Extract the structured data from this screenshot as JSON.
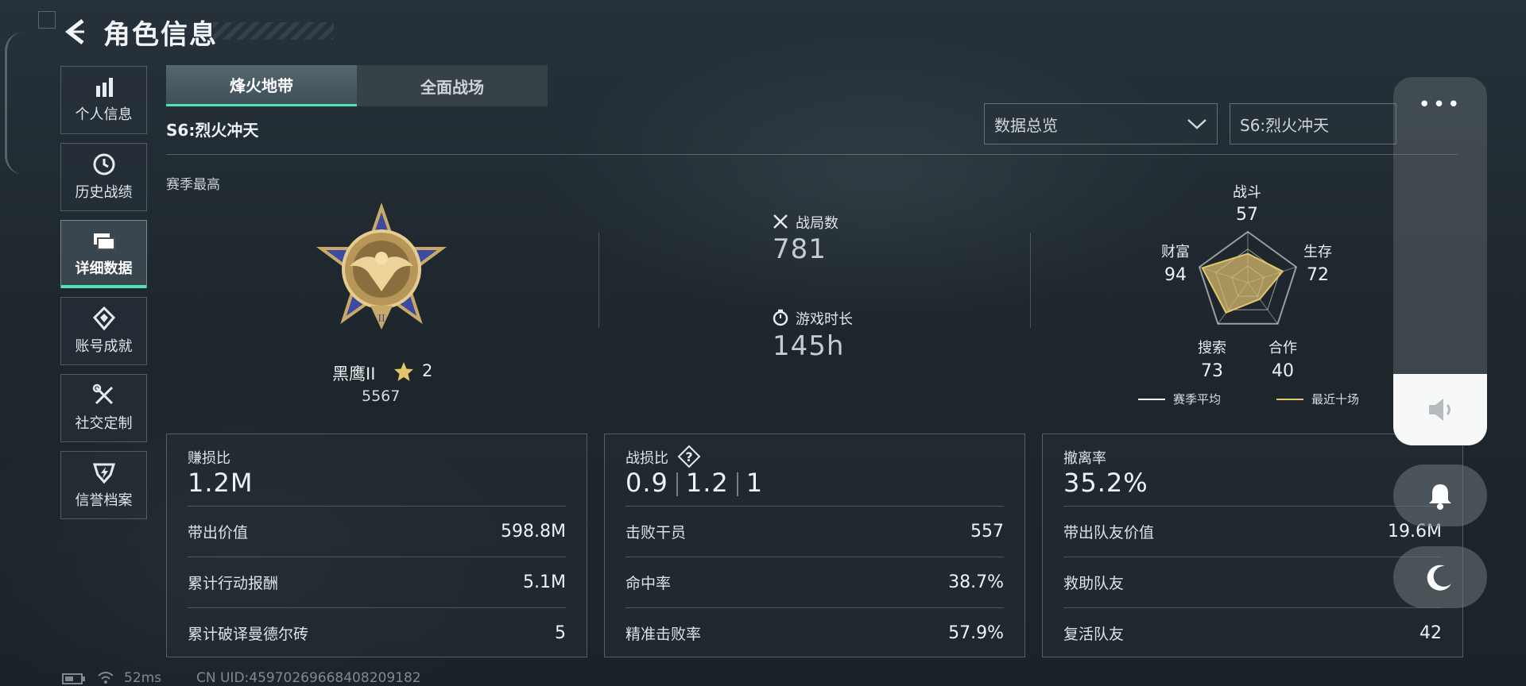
{
  "header": {
    "title": "角色信息"
  },
  "sidebar": {
    "items": [
      {
        "label": "个人信息",
        "icon": "bar-chart-icon"
      },
      {
        "label": "历史战绩",
        "icon": "clock-icon"
      },
      {
        "label": "详细数据",
        "icon": "folders-icon",
        "active": true
      },
      {
        "label": "账号成就",
        "icon": "achievement-icon"
      },
      {
        "label": "社交定制",
        "icon": "tools-icon"
      },
      {
        "label": "信誉档案",
        "icon": "shield-icon"
      }
    ]
  },
  "tabs": [
    {
      "label": "烽火地带",
      "active": true
    },
    {
      "label": "全面战场",
      "active": false
    }
  ],
  "season": {
    "label": "S6:烈火冲天",
    "best_label": "赛季最高"
  },
  "filters": {
    "mode": "数据总览",
    "season": "S6:烈火冲天"
  },
  "rank": {
    "name": "黑鹰II",
    "stars": "2",
    "score": "5567"
  },
  "overview": {
    "matches_label": "战局数",
    "matches": "781",
    "playtime_label": "游戏时长",
    "playtime": "145h"
  },
  "radar": {
    "axes": [
      {
        "label": "战斗",
        "value": "57"
      },
      {
        "label": "生存",
        "value": "72"
      },
      {
        "label": "合作",
        "value": "40"
      },
      {
        "label": "搜索",
        "value": "73"
      },
      {
        "label": "财富",
        "value": "94"
      }
    ],
    "recent_fractions": [
      0.57,
      0.72,
      0.4,
      0.73,
      0.94
    ],
    "legend": {
      "season_avg": "赛季平均",
      "recent": "最近十场"
    },
    "colors": {
      "season_avg": "#ffffff",
      "recent": "#e3c56a"
    }
  },
  "cards": {
    "profit": {
      "title": "赚损比",
      "value": "1.2M",
      "rows": [
        {
          "label": "带出价值",
          "value": "598.8M"
        },
        {
          "label": "累计行动报酬",
          "value": "5.1M"
        },
        {
          "label": "累计破译曼德尔砖",
          "value": "5"
        }
      ]
    },
    "kd": {
      "title": "战损比",
      "values": [
        "0.9",
        "1.2",
        "1"
      ],
      "rows": [
        {
          "label": "击败干员",
          "value": "557"
        },
        {
          "label": "命中率",
          "value": "38.7%"
        },
        {
          "label": "精准击败率",
          "value": "57.9%"
        }
      ]
    },
    "extract": {
      "title": "撤离率",
      "value": "35.2%",
      "rows": [
        {
          "label": "带出队友价值",
          "value": "19.6M"
        },
        {
          "label": "救助队友",
          "value": ""
        },
        {
          "label": "复活队友",
          "value": "42"
        }
      ]
    }
  },
  "status_bar": {
    "ping": "52ms",
    "uid": "CN UID:4597026966840820918​2"
  },
  "accent": "#4ee3b0"
}
